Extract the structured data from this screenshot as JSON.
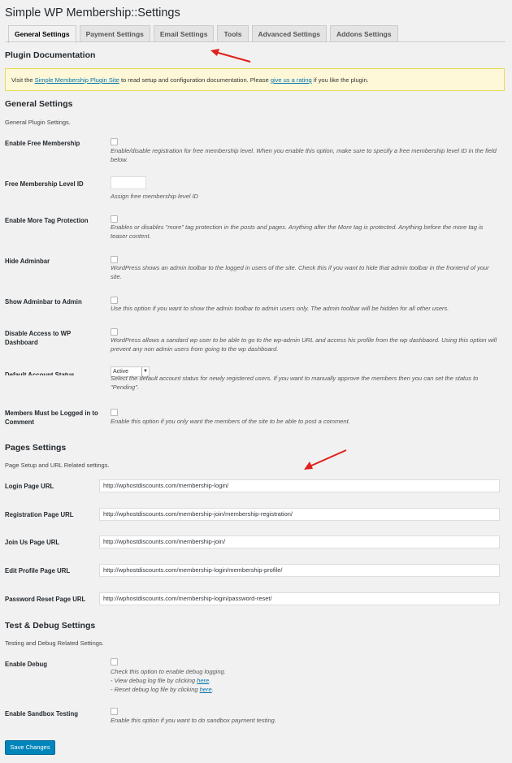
{
  "page": {
    "title": "Simple WP Membership::Settings"
  },
  "tabs": [
    "General Settings",
    "Payment Settings",
    "Email Settings",
    "Tools",
    "Advanced Settings",
    "Addons Settings"
  ],
  "plugin_doc": {
    "heading": "Plugin Documentation",
    "notice_before": "Visit the ",
    "notice_link1": "Simple Membership Plugin Site",
    "notice_middle": " to read setup and configuration documentation. Please ",
    "notice_link2": "give us a rating",
    "notice_after": " if you like the plugin."
  },
  "general": {
    "heading": "General Settings",
    "description": "General Plugin Settings.",
    "free_membership": {
      "label": "Enable Free Membership",
      "desc": "Enable/disable registration for free membership level. When you enable this option, make sure to specify a free membership level ID in the field below."
    },
    "free_level_id": {
      "label": "Free Membership Level ID",
      "value": "",
      "desc": "Assign free membership level ID"
    },
    "more_tag": {
      "label": "Enable More Tag Protection",
      "desc": "Enables or disables \"more\" tag protection in the posts and pages. Anything after the More tag is protected. Anything before the more tag is teaser content."
    },
    "hide_adminbar": {
      "label": "Hide Adminbar",
      "desc": "WordPress shows an admin toolbar to the logged in users of the site. Check this if you want to hide that admin toolbar in the frontend of your site."
    },
    "show_adminbar_admin": {
      "label": "Show Adminbar to Admin",
      "desc": "Use this option if you want to show the admin toolbar to admin users only. The admin toolbar will be hidden for all other users."
    },
    "disable_wp_dashboard": {
      "label": "Disable Access to WP Dashboard",
      "desc": "WordPress allows a sandard wp user to be able to go to the wp-admin URL and access his profile from the wp dashbaord. Using this option will prevent any non admin users from going to the wp dashboard."
    },
    "default_status": {
      "label": "Default Account Status",
      "selected": "Active",
      "desc": "Select the default account status for newly registered users. If you want to manually approve the members then you can set the status to \"Pending\"."
    },
    "logged_in_comment": {
      "label": "Members Must be Logged in to Comment",
      "desc": "Enable this option if you only want the members of the site to be able to post a comment."
    }
  },
  "pages": {
    "heading": "Pages Settings",
    "description": "Page Setup and URL Related settings.",
    "login": {
      "label": "Login Page URL",
      "value": "http://wphostdiscounts.com/membership-login/"
    },
    "registration": {
      "label": "Registration Page URL",
      "value": "http://wphostdiscounts.com/membership-join/membership-registration/"
    },
    "join_us": {
      "label": "Join Us Page URL",
      "value": "http://wphostdiscounts.com/membership-join/"
    },
    "edit_profile": {
      "label": "Edit Profile Page URL",
      "value": "http://wphostdiscounts.com/membership-login/membership-profile/"
    },
    "password_reset": {
      "label": "Password Reset Page URL",
      "value": "http://wphostdiscounts.com/membership-login/password-reset/"
    }
  },
  "debug": {
    "heading": "Test & Debug Settings",
    "description": "Testing and Debug Related Settings.",
    "enable_debug": {
      "label": "Enable Debug",
      "desc1": "Check this option to enable debug logging.",
      "desc2": "- View debug log file by clicking ",
      "desc3": "- Reset debug log file by clicking ",
      "link": "here",
      "period": "."
    },
    "sandbox": {
      "label": "Enable Sandbox Testing",
      "desc": "Enable this option if you want to do sandbox payment testing."
    }
  },
  "save_button": "Save Changes",
  "colors": {
    "accent": "#0085ba",
    "link": "#0073aa",
    "annotation": "#e0201c",
    "notice_bg": "#fff8d8"
  }
}
